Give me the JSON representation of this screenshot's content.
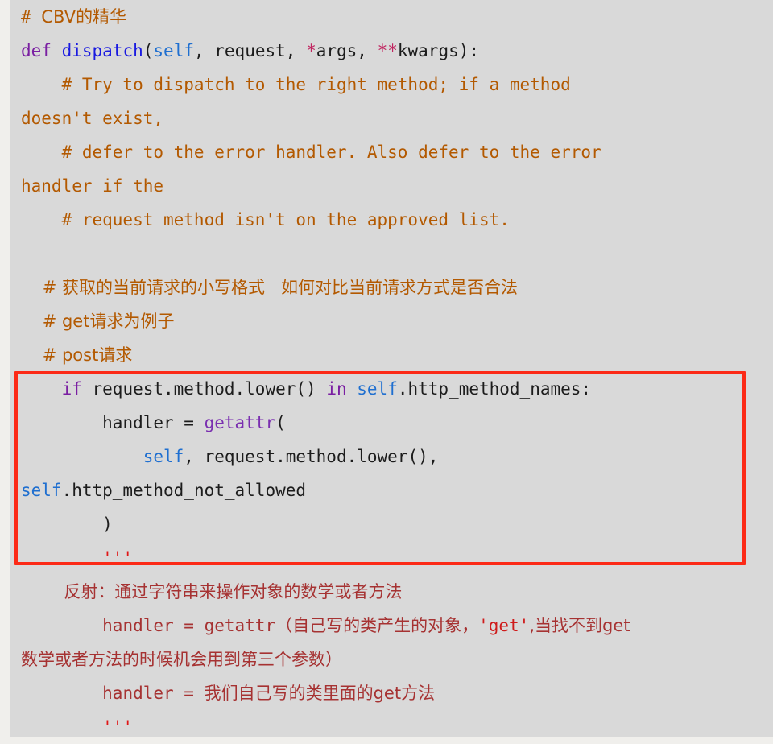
{
  "editor": {
    "background_color": "#d9d9d9",
    "gutter_color": "#f0efec",
    "highlight_color": "#fc2a17",
    "comment_color": "#b35900",
    "keyword_color": "#7a1fa2",
    "self_color": "#1f6fd0",
    "docstring_color": "#a63232",
    "string_color": "#cf1b1b"
  },
  "code": {
    "line01": {
      "hash": "# ",
      "text": "CBV的精华"
    },
    "line02": {
      "kw_def": "def",
      "space": " ",
      "name": "dispatch",
      "paren_open": "(",
      "self": "self",
      "args": ", request, ",
      "star1": "*",
      "a_args": "args, ",
      "star2": "**",
      "kwargs": "kwargs):"
    },
    "line03": "    # Try to dispatch to the right method; if a method",
    "line04": "doesn't exist,",
    "line05": "    # defer to the error handler. Also defer to the error",
    "line06": "handler if the",
    "line07": "    # request method isn't on the approved list.",
    "line08": "",
    "line09": "    # 获取的当前请求的小写格式   如何对比当前请求方式是否合法",
    "line10": "    # get请求为例子",
    "line11": "    # post请求",
    "line12": {
      "indent": "    ",
      "kw_if": "if",
      "expr": " request.method.lower() ",
      "kw_in": "in",
      "space": " ",
      "self": "self",
      "attr": ".http_method_names:"
    },
    "line13": {
      "indent": "        ",
      "assign": "handler = ",
      "builtin": "getattr",
      "paren": "("
    },
    "line14": {
      "indent": "            ",
      "self": "self",
      "rest": ", request.method.lower(),"
    },
    "line15": {
      "self": "self",
      "rest": ".http_method_not_allowed"
    },
    "line16": "        )",
    "line17": "        '''",
    "line18": "        反射：通过字符串来操作对象的数学或者方法",
    "line19": {
      "indent": "        ",
      "code": "handler = getattr",
      "cn_open": "（自己写的类产生的对象，",
      "str": "'get'",
      "cn_tail": ",当找不到get"
    },
    "line20": "数学或者方法的时候机会用到第三个参数）",
    "line21": {
      "indent": "        ",
      "code": "handler = ",
      "cn": "我们自己写的类里面的get方法"
    },
    "line22": "        '''"
  }
}
